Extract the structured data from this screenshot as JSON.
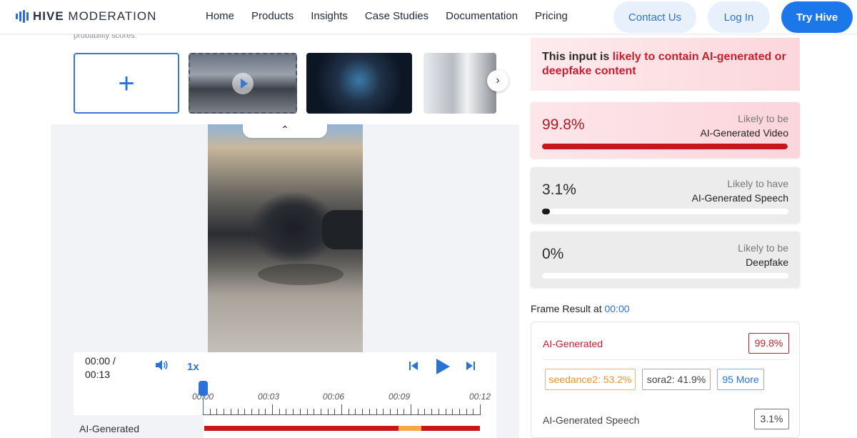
{
  "header": {
    "logo_bold": "HIVE",
    "logo_light": " MODERATION",
    "nav": [
      "Home",
      "Products",
      "Insights",
      "Case Studies",
      "Documentation",
      "Pricing"
    ],
    "contact_label": "Contact Us",
    "login_label": "Log In",
    "try_label": "Try Hive"
  },
  "cut_text": "probability scores.",
  "thumbnails": {
    "upload_symbol": "+",
    "next_symbol": "›"
  },
  "player": {
    "collapse_symbol": "⌃",
    "time_current": "00:00 /",
    "time_total": "00:13",
    "speed": "1x",
    "timeline_ticks": [
      "00:00",
      "00:03",
      "00:06",
      "00:09",
      "00:12"
    ],
    "track_label": "AI-Generated"
  },
  "result": {
    "alert_prefix": "This input is ",
    "alert_highlight": "likely to contain AI-generated or deepfake content",
    "cards": [
      {
        "pct": "99.8%",
        "line1": "Likely to be",
        "line2": "AI-Generated Video",
        "level": 0.998
      },
      {
        "pct": "3.1%",
        "line1": "Likely to have",
        "line2": "AI-Generated Speech",
        "level": 0.031
      },
      {
        "pct": "0%",
        "line1": "Likely to be",
        "line2": "Deepfake",
        "level": 0.0
      }
    ],
    "frame_title": "Frame Result at ",
    "frame_time": "00:00",
    "frame_ai_label": "AI-Generated",
    "frame_ai_value": "99.8%",
    "chips": [
      "seedance2: 53.2%",
      "sora2: 41.9%",
      "95 More"
    ],
    "frame_speech_label": "AI-Generated Speech",
    "frame_speech_value": "3.1%"
  },
  "colors": {
    "accent": "#1c77e8",
    "danger": "#c8161e",
    "warning": "#f4a949"
  },
  "icons": [
    "logo-bars-icon",
    "plus-icon",
    "play-icon",
    "chevron-right-icon",
    "chevron-up-icon",
    "volume-icon",
    "skip-back-icon",
    "play-icon",
    "skip-forward-icon"
  ]
}
